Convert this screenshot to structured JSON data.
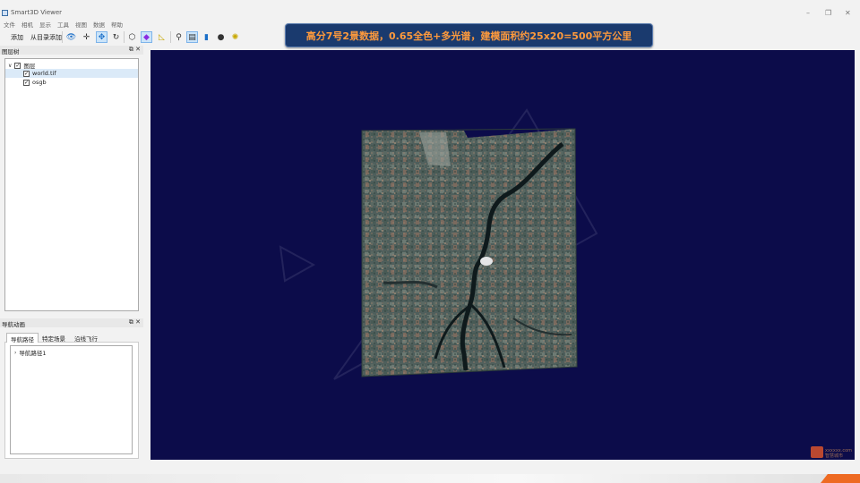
{
  "app": {
    "title": "Smart3D Viewer",
    "controls": [
      "–",
      "❐",
      "✕"
    ]
  },
  "menu": [
    "文件",
    "相机",
    "显示",
    "工具",
    "视图",
    "数据",
    "帮助"
  ],
  "toolbar": {
    "add_label": "添加",
    "add_from_dir_label": "从目录添加"
  },
  "banner": {
    "text": "高分7号2景数据，0.65全色+多光谱，建模面积约25x20=500平方公里"
  },
  "layer_panel": {
    "title": "图层树",
    "root": "图层",
    "items": [
      "world.tif",
      "osgb"
    ]
  },
  "nav_panel": {
    "title": "导航动画",
    "tabs": [
      "导航路径",
      "特定场景",
      "沿线飞行"
    ],
    "items": [
      "导航路径1"
    ]
  },
  "watermark": {
    "line1": "xxxxxx.com",
    "line2": "智慧城市"
  },
  "colors": {
    "viewport_bg": "#0c0c4a",
    "banner_bg": "#1a3a6e",
    "banner_text": "#ff9a3c",
    "accent": "#ee6a22"
  }
}
